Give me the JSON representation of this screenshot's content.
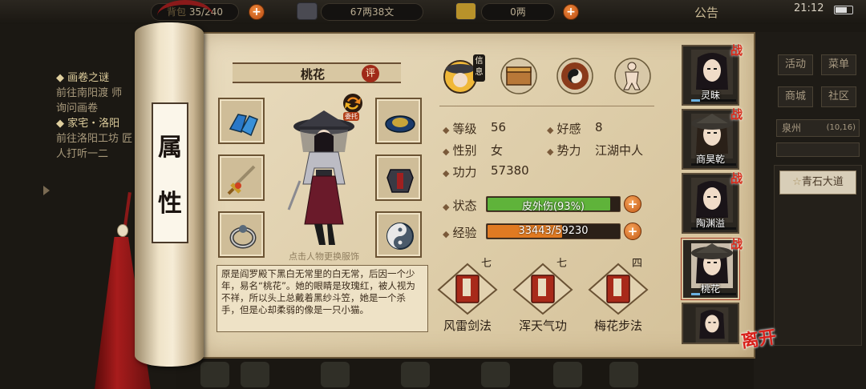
{
  "topbar": {
    "bag_label": "背包",
    "bag_count": "35/240",
    "money": "67两38文",
    "gold": "0两",
    "notice": "公告",
    "clock": "21:12"
  },
  "quests": [
    {
      "title": "画卷之谜",
      "desc": "前往南阳渡 师询问画卷"
    },
    {
      "title": "家宅・洛阳",
      "desc": "前往洛阳工坊 匠人打听一二"
    }
  ],
  "scroll_label": [
    "属",
    "性"
  ],
  "character": {
    "name": "桃花",
    "rate_label": "评",
    "outfit_label": "委托",
    "hint": "点击人物更换服饰",
    "description": "原是阎罗殿下黑白无常里的白无常，后因一个少年，易名“桃花”。她的眼睛是玫瑰红，被人视为不祥，所以头上总戴着黑纱斗笠，她是一个杀手，但是心却柔弱的像是一只小猫。"
  },
  "info_tag": "信息",
  "attributes": {
    "level_label": "等级",
    "level": "56",
    "favor_label": "好感",
    "favor": "8",
    "gender_label": "性别",
    "gender": "女",
    "faction_label": "势力",
    "faction": "江湖中人",
    "power_label": "功力",
    "power": "57380"
  },
  "status": {
    "label": "状态",
    "text": "皮外伤(93%)",
    "percent": 93,
    "color": "#5fb33a"
  },
  "exp": {
    "label": "经验",
    "text": "33443/59230",
    "current": 33443,
    "max": 59230,
    "color": "#e07a22"
  },
  "skills": [
    {
      "name": "风雷剑法",
      "level": "七"
    },
    {
      "name": "浑天气功",
      "level": "七"
    },
    {
      "name": "梅花步法",
      "level": "四"
    }
  ],
  "party": [
    {
      "name": "灵昧",
      "tag": "战",
      "hp": 0.2,
      "hat": false
    },
    {
      "name": "商昊乾",
      "tag": "战",
      "hp": 0,
      "hat": true
    },
    {
      "name": "陶渊溢",
      "tag": "战",
      "hp": 0,
      "hat": false
    },
    {
      "name": "桃花",
      "tag": "战",
      "hp": 0.2,
      "hat": true,
      "selected": true
    },
    {
      "name": "",
      "tag": "",
      "hp": 0,
      "hat": false
    }
  ],
  "leave_label": "离开",
  "right_menu": {
    "activity": "活动",
    "menu": "菜单",
    "shop": "商城",
    "community": "社区",
    "location": "泉州",
    "coords": "(10,16)",
    "road": "青石大道"
  },
  "colors": {
    "accent": "#a02a18",
    "paper": "#e3d4b2",
    "bar_status": "#5fb33a",
    "bar_exp": "#e07a22"
  }
}
